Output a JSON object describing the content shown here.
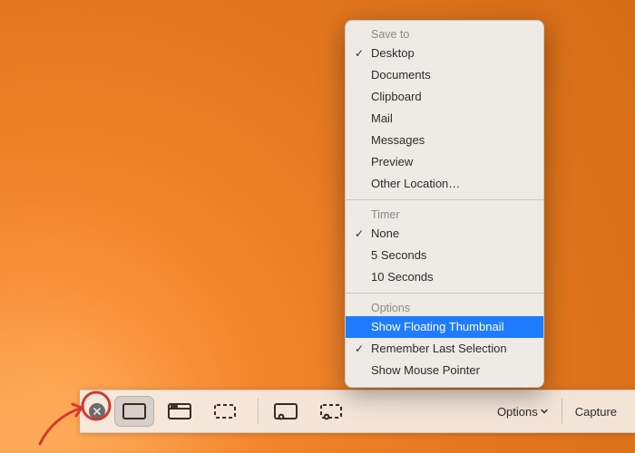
{
  "toolbar": {
    "buttons": {
      "options_label": "Options",
      "capture_label": "Capture"
    }
  },
  "menu": {
    "sections": [
      {
        "title": "Save to",
        "items": [
          {
            "label": "Desktop",
            "checked": true
          },
          {
            "label": "Documents"
          },
          {
            "label": "Clipboard"
          },
          {
            "label": "Mail"
          },
          {
            "label": "Messages"
          },
          {
            "label": "Preview"
          },
          {
            "label": "Other Location…"
          }
        ]
      },
      {
        "title": "Timer",
        "items": [
          {
            "label": "None",
            "checked": true
          },
          {
            "label": "5 Seconds"
          },
          {
            "label": "10 Seconds"
          }
        ]
      },
      {
        "title": "Options",
        "items": [
          {
            "label": "Show Floating Thumbnail",
            "highlight": true
          },
          {
            "label": "Remember Last Selection",
            "checked": true
          },
          {
            "label": "Show Mouse Pointer"
          }
        ]
      }
    ]
  }
}
